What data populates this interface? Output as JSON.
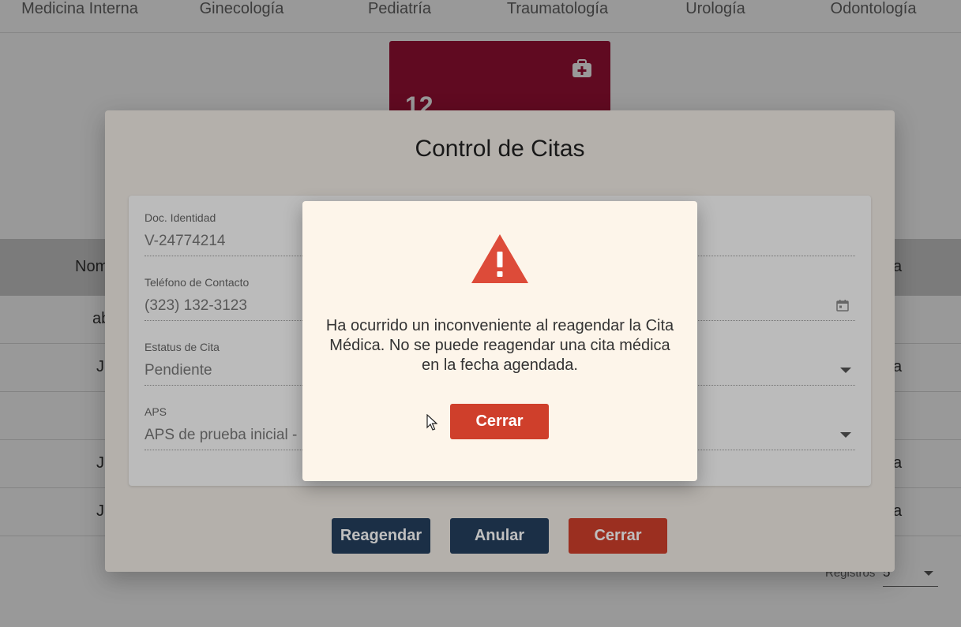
{
  "nav": {
    "tabs": [
      "Medicina Interna",
      "Ginecología",
      "Pediatría",
      "Traumatología",
      "Urología",
      "Odontología"
    ]
  },
  "stat_card": {
    "value": "12",
    "icon": "medkit-icon",
    "color": "#a01238"
  },
  "table": {
    "header_left": "Nom",
    "header_right": "a",
    "rows": [
      {
        "left": "ab",
        "right": ""
      },
      {
        "left": "J",
        "right": "a"
      },
      {
        "left": "",
        "right": ""
      },
      {
        "left": "J",
        "right": "a"
      },
      {
        "left": "J",
        "right": "a"
      }
    ]
  },
  "pagination": {
    "label": "Registros",
    "value": "5"
  },
  "modal": {
    "title": "Control de Citas",
    "fields": {
      "doc_label": "Doc. Identidad",
      "doc_value": "V-24774214",
      "phone_label": "Teléfono de Contacto",
      "phone_value": "(323) 132-3123",
      "status_label": "Estatus de Cita",
      "status_value": "Pendiente",
      "aps_label": "APS",
      "aps_value": "APS de prueba inicial -"
    },
    "buttons": {
      "reschedule": "Reagendar",
      "cancel": "Anular",
      "close": "Cerrar"
    }
  },
  "alert": {
    "icon": "warning-icon",
    "message": "Ha ocurrido un inconveniente al reagendar la Cita Médica. No se puede reagendar una cita médica en la fecha agendada.",
    "button": "Cerrar"
  },
  "colors": {
    "navy": "#253f5e",
    "red": "#cf3f2b",
    "warning": "#dd4b39"
  }
}
